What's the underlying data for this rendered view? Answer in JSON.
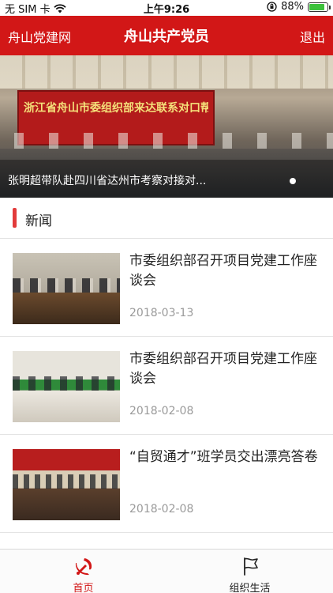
{
  "status_bar": {
    "carrier": "无 SIM 卡",
    "time": "上午9:26",
    "battery_percent": "88%",
    "battery_level": 0.88
  },
  "nav": {
    "left_label": "舟山党建网",
    "title": "舟山共产党员",
    "right_label": "退出"
  },
  "banner": {
    "backdrop_text": "浙江省舟山市委组织部来达联系对口帮扶工作座谈会",
    "caption": "张明超带队赴四川省达州市考察对接对...",
    "pager_active_index": 0
  },
  "section": {
    "title": "新闻"
  },
  "news": [
    {
      "title": "市委组织部召开项目党建工作座谈会",
      "date": "2018-03-13"
    },
    {
      "title": "市委组织部召开项目党建工作座谈会",
      "date": "2018-02-08"
    },
    {
      "title": "“自贸通才”班学员交出漂亮答卷",
      "date": "2018-02-08"
    }
  ],
  "tabs": [
    {
      "label": "首页",
      "icon": "party-emblem-icon",
      "active": true
    },
    {
      "label": "组织生活",
      "icon": "flag-icon",
      "active": false
    }
  ],
  "colors": {
    "brand_red": "#d21717",
    "accent_bar": "#e23b3b",
    "date_gray": "#9a9a9a",
    "battery_green": "#3cc13b"
  }
}
